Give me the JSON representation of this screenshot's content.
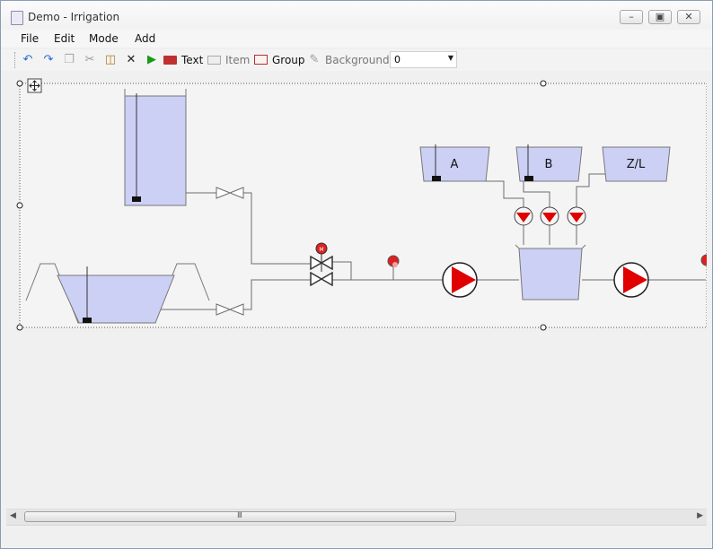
{
  "window": {
    "title": "Demo - Irrigation",
    "controls": {
      "minimize": "minimize",
      "maximize": "maximize",
      "close": "close"
    }
  },
  "menu": {
    "items": [
      {
        "label": "File"
      },
      {
        "label": "Edit"
      },
      {
        "label": "Mode"
      },
      {
        "label": "Add"
      }
    ]
  },
  "toolbar": {
    "undo_icon": "undo-icon",
    "redo_icon": "redo-icon",
    "copy_icon": "copy-icon",
    "cut_icon": "cut-icon",
    "paste_icon": "paste-icon",
    "delete_icon": "delete-icon",
    "run_icon": "play-icon",
    "text_label": "Text",
    "item_label": "Item",
    "group_label": "Group",
    "background_label": "Background",
    "combo_value": "0"
  },
  "diagram": {
    "tank_labels": [
      "A",
      "B",
      "Z/L"
    ],
    "colors": {
      "tank_fill": "#ccd0f5",
      "pump_red": "#e00000",
      "line": "#6b6b6b",
      "indicator_red": "#e02020"
    }
  },
  "scrollbar": {
    "grip": "III"
  }
}
